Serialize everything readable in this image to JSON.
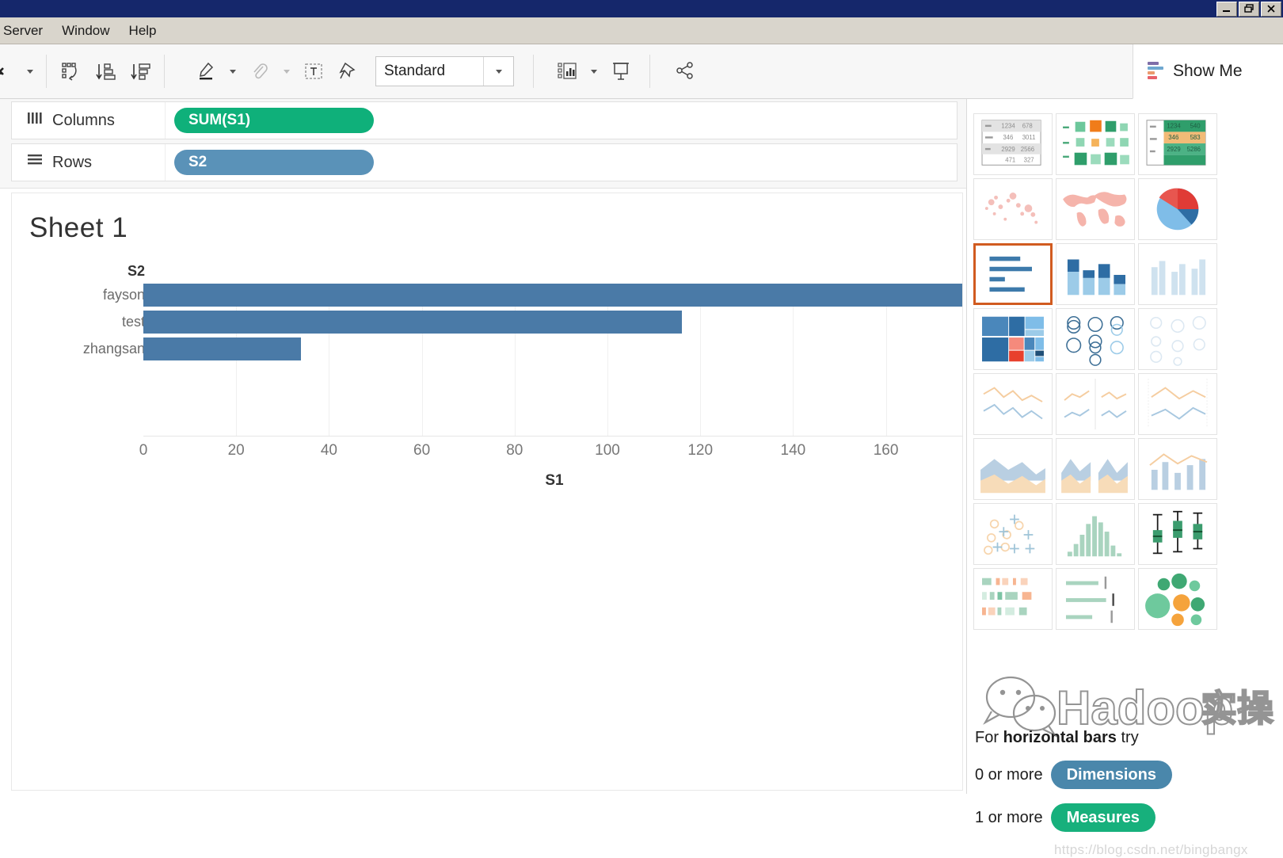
{
  "window": {
    "controls": [
      {
        "name": "minimize",
        "glyph": "_"
      },
      {
        "name": "restore",
        "glyph": "❐"
      },
      {
        "name": "close",
        "glyph": "✕"
      }
    ]
  },
  "menubar": {
    "items": [
      "Server",
      "Window",
      "Help"
    ]
  },
  "toolbar": {
    "standard_label": "Standard",
    "show_me_label": "Show Me",
    "buttons": [
      "undo-redo-icon",
      "swap-rows-columns-icon",
      "sort-ascending-icon",
      "sort-descending-icon",
      "highlighter-icon",
      "paperclip-icon",
      "text-box-icon",
      "pin-icon",
      "fit-icon",
      "presentation-mode-icon",
      "share-icon"
    ]
  },
  "shelves": {
    "columns": {
      "label": "Columns",
      "pill": "SUM(S1)",
      "pill_color": "#0fb07a"
    },
    "rows": {
      "label": "Rows",
      "pill": "S2",
      "pill_color": "#5a92b8"
    }
  },
  "view": {
    "sheet_title": "Sheet 1"
  },
  "chart_data": {
    "type": "bar",
    "orientation": "horizontal",
    "title": "Sheet 1",
    "row_header_title": "S2",
    "categories": [
      "fayson",
      "test",
      "zhangsan"
    ],
    "values": [
      178,
      116,
      34
    ],
    "xlabel": "S1",
    "ylabel": "S2",
    "xlim": [
      0,
      178
    ],
    "xticks": [
      0,
      20,
      40,
      60,
      80,
      100,
      120,
      140,
      160
    ],
    "xtick_labels": [
      "0",
      "20",
      "40",
      "60",
      "80",
      "100",
      "120",
      "140",
      "160"
    ],
    "bar_color": "#4a7aa7",
    "grid": true,
    "legend": "none",
    "note": "fayson bar is clipped by the right edge of the view pane"
  },
  "show_me": {
    "hint_prefix": "For ",
    "hint_bold": "horizontal bars",
    "hint_suffix": " try",
    "requirements": [
      {
        "text": "0 or more",
        "pill": "Dimensions",
        "color": "#4a87ab"
      },
      {
        "text": "1 or more",
        "pill": "Measures",
        "color": "#17b07c"
      }
    ],
    "thumbs": [
      {
        "name": "text-table",
        "row": 1
      },
      {
        "name": "heat-map",
        "row": 1
      },
      {
        "name": "highlight-table",
        "row": 1
      },
      {
        "name": "symbol-map",
        "row": 2
      },
      {
        "name": "filled-map",
        "row": 2
      },
      {
        "name": "pie-chart",
        "row": 2
      },
      {
        "name": "horizontal-bars",
        "row": 3,
        "selected": true
      },
      {
        "name": "stacked-bars",
        "row": 3
      },
      {
        "name": "side-by-side-bars",
        "row": 3
      },
      {
        "name": "treemap",
        "row": 4
      },
      {
        "name": "circle-views",
        "row": 4
      },
      {
        "name": "side-by-side-circle-views",
        "row": 4
      },
      {
        "name": "continuous-lines",
        "row": 5
      },
      {
        "name": "lines-discrete",
        "row": 5
      },
      {
        "name": "dual-lines",
        "row": 5
      },
      {
        "name": "area-charts-continuous",
        "row": 6
      },
      {
        "name": "area-charts-discrete",
        "row": 6
      },
      {
        "name": "dual-combination",
        "row": 6
      },
      {
        "name": "scatter-plot",
        "row": 7
      },
      {
        "name": "histogram",
        "row": 7
      },
      {
        "name": "box-and-whisker-plot",
        "row": 7
      },
      {
        "name": "gantt-chart",
        "row": 8
      },
      {
        "name": "bullet-graph",
        "row": 8
      },
      {
        "name": "packed-bubbles",
        "row": 8
      }
    ]
  },
  "watermark": {
    "text": "Hadoop实操",
    "url": "https://blog.csdn.net/bingbangx"
  }
}
